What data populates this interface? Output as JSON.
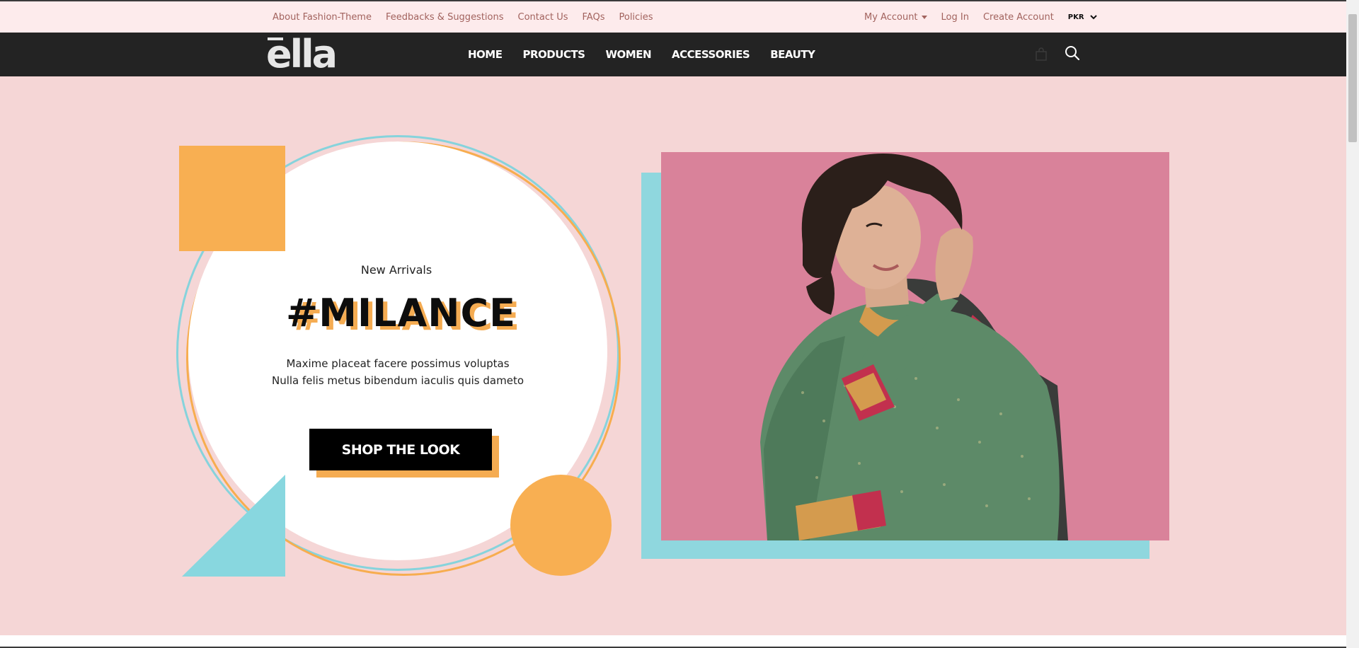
{
  "topbar": {
    "links": [
      "About Fashion-Theme",
      "Feedbacks & Suggestions",
      "Contact Us",
      "FAQs",
      "Policies"
    ],
    "my_account": "My Account",
    "log_in": "Log In",
    "create_account": "Create Account",
    "currency": "PKR"
  },
  "header": {
    "logo": "ella",
    "nav": [
      "HOME",
      "PRODUCTS",
      "WOMEN",
      "ACCESSORIES",
      "BEAUTY"
    ],
    "icons": [
      "cart-icon",
      "search-icon"
    ]
  },
  "hero": {
    "eyebrow": "New Arrivals",
    "title": "#MILANCE",
    "desc_line1": "Maxime placeat facere possimus voluptas",
    "desc_line2": "Nulla felis metus bibendum iaculis quis dameto",
    "cta": "SHOP THE LOOK",
    "colors": {
      "background": "#f5d6d6",
      "accent_orange": "#f8af52",
      "accent_blue": "#88d7df",
      "photo_bg": "#d9829a"
    }
  }
}
